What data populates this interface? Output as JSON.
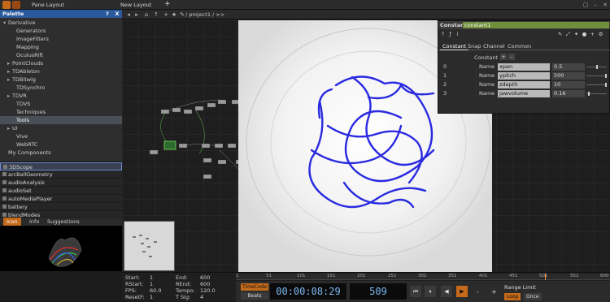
{
  "topbar": {
    "pane_layout": "Pane Layout",
    "new_layout": "New Layout",
    "add": "+"
  },
  "palette": {
    "title": "Palette",
    "help": "?",
    "close": "X",
    "tree": [
      {
        "label": "Derivative",
        "arrow": "▾",
        "depth": 0
      },
      {
        "label": "Generators",
        "arrow": "",
        "depth": 2
      },
      {
        "label": "ImageFilters",
        "arrow": "",
        "depth": 2
      },
      {
        "label": "Mapping",
        "arrow": "",
        "depth": 2
      },
      {
        "label": "OculusRift",
        "arrow": "",
        "depth": 2
      },
      {
        "label": "PointClouds",
        "arrow": "▸",
        "depth": 1
      },
      {
        "label": "TDAbleton",
        "arrow": "▸",
        "depth": 1
      },
      {
        "label": "TDBitwig",
        "arrow": "▸",
        "depth": 1
      },
      {
        "label": "TDSynchro",
        "arrow": "",
        "depth": 2
      },
      {
        "label": "TDVR",
        "arrow": "▸",
        "depth": 1
      },
      {
        "label": "TDVS",
        "arrow": "",
        "depth": 2
      },
      {
        "label": "Techniques",
        "arrow": "",
        "depth": 2
      },
      {
        "label": "Tools",
        "arrow": "",
        "depth": 2,
        "selected": true
      },
      {
        "label": "UI",
        "arrow": "▸",
        "depth": 1
      },
      {
        "label": "Vive",
        "arrow": "",
        "depth": 2
      },
      {
        "label": "WebRTC",
        "arrow": "",
        "depth": 2
      },
      {
        "label": "My Components",
        "arrow": "",
        "depth": 0
      }
    ],
    "ops": [
      "3DScope",
      "arcBallGeometry",
      "audioAnalysis",
      "audioSet",
      "autoMediaPlayer",
      "battery",
      "blendModes"
    ],
    "bottom_tabs": [
      "Icon",
      "Info",
      "Suggestions"
    ]
  },
  "network": {
    "path": "/ project1 / >>"
  },
  "param": {
    "type_label": "Constant",
    "name": "constant1",
    "tabs": [
      "Constant",
      "Snap",
      "Channel",
      "Common"
    ],
    "section": "Constant",
    "rows": [
      {
        "idx": "0",
        "label": "Name",
        "name": "xpan",
        "value": "0.5",
        "level": 0.5
      },
      {
        "idx": "1",
        "label": "Name",
        "name": "ypitch",
        "value": "500",
        "level": 0.95
      },
      {
        "idx": "2",
        "label": "Name",
        "name": "zdepth",
        "value": "10",
        "level": 0.95
      },
      {
        "idx": "3",
        "label": "Name",
        "name": "jawvolume",
        "value": "0.16",
        "level": 0.1
      }
    ]
  },
  "timeline": {
    "info": [
      {
        "k": "Start:",
        "v": "1"
      },
      {
        "k": "End:",
        "v": "600"
      },
      {
        "k": "RStart:",
        "v": "1"
      },
      {
        "k": "REnd:",
        "v": "600"
      },
      {
        "k": "FPS:",
        "v": "60.0"
      },
      {
        "k": "Tempo:",
        "v": "120.0"
      },
      {
        "k": "ResetF:",
        "v": "1"
      },
      {
        "k": "T Sig:",
        "v": "4"
      },
      {
        "k": "",
        "v": "4"
      }
    ],
    "ruler": [
      "1",
      "51",
      "101",
      "151",
      "201",
      "251",
      "301",
      "351",
      "401",
      "451",
      "501",
      "551",
      "600"
    ],
    "cursor_frame": 509,
    "timecode_btn": "TimeCode",
    "beats_btn": "Beats",
    "timecode": "00:00:08:29",
    "frame": "509",
    "range_limit": "Range Limit",
    "loop": "Loop",
    "once": "Once",
    "minus": "-",
    "plus": "+"
  }
}
